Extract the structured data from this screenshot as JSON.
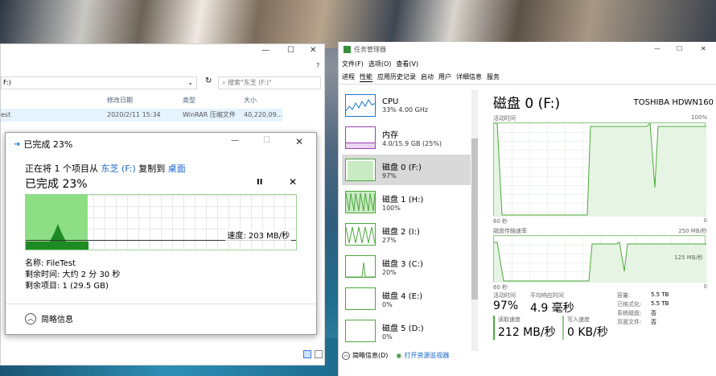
{
  "explorer": {
    "address": "F:)",
    "search_placeholder": "搜索\"东芝 (F:)\"",
    "columns": [
      "修改日期",
      "类型",
      "大小"
    ],
    "row": {
      "name": "est",
      "modified": "2020/2/11 15:34",
      "type": "WinRAR 压缩文件",
      "size": "40,220,09..."
    }
  },
  "copy_dialog": {
    "title": "已完成 23%",
    "line_prefix": "正在将 1 个项目从",
    "source": "东芝 (F:)",
    "line_mid": "复制到",
    "dest": "桌面",
    "percent_text": "已完成 23%",
    "progress": 0.23,
    "speed": "速度: 203 MB/秒",
    "name": "名称: FileTest",
    "time_left": "剩余时间: 大约 2 分 30 秒",
    "items_left": "剩余项目: 1 (29.5 GB)",
    "details": "简略信息"
  },
  "taskmgr": {
    "title": "任务管理器",
    "menu": [
      "文件(F)",
      "选项(O)",
      "查看(V)"
    ],
    "tabs": [
      "进程",
      "性能",
      "应用历史记录",
      "启动",
      "用户",
      "详细信息",
      "服务"
    ],
    "active_tab": "性能",
    "devices": [
      {
        "name": "CPU",
        "value": "33% 4.00 GHz",
        "color": "#1a76c8"
      },
      {
        "name": "内存",
        "value": "4.0/15.9 GB (25%)",
        "color": "#9b3fb6"
      },
      {
        "name": "磁盘 0 (F:)",
        "value": "97%",
        "color": "#4da83d"
      },
      {
        "name": "磁盘 1 (H:)",
        "value": "100%",
        "color": "#4da83d"
      },
      {
        "name": "磁盘 2 (I:)",
        "value": "27%",
        "color": "#4da83d"
      },
      {
        "name": "磁盘 3 (C:)",
        "value": "20%",
        "color": "#4da83d"
      },
      {
        "name": "磁盘 4 (E:)",
        "value": "0%",
        "color": "#4da83d"
      },
      {
        "name": "磁盘 5 (D:)",
        "value": "0%",
        "color": "#4da83d"
      }
    ],
    "detail": {
      "title": "磁盘 0 (F:)",
      "model": "TOSHIBA HDWN160",
      "chart1_label": "活动时间",
      "chart1_max": "100%",
      "chart2_label": "磁盘传输速率",
      "chart2_max": "250 MB/秒",
      "chart2_mid": "125 MB/秒",
      "axis_left": "60 秒",
      "axis_right": "0",
      "active_time_label": "活动时间",
      "active_time": "97%",
      "response_label": "平均响应时间",
      "response": "4.9 毫秒",
      "read_label": "读取速度",
      "read": "212 MB/秒",
      "write_label": "写入速度",
      "write": "0 KB/秒",
      "props": [
        {
          "k": "容量:",
          "v": "5.5 TB"
        },
        {
          "k": "已格式化:",
          "v": "5.5 TB"
        },
        {
          "k": "系统磁盘:",
          "v": "否"
        },
        {
          "k": "页面文件:",
          "v": "否"
        }
      ]
    },
    "footer_brief": "简略信息(D)",
    "footer_link": "打开资源监视器"
  }
}
